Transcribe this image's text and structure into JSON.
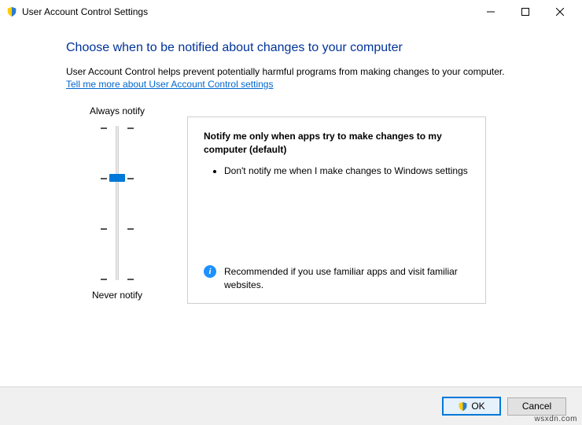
{
  "window": {
    "title": "User Account Control Settings"
  },
  "content": {
    "heading": "Choose when to be notified about changes to your computer",
    "description": "User Account Control helps prevent potentially harmful programs from making changes to your computer.",
    "link_text": "Tell me more about User Account Control settings"
  },
  "slider": {
    "top_label": "Always notify",
    "bottom_label": "Never notify",
    "levels": 4,
    "selected_index": 1
  },
  "panel": {
    "title": "Notify me only when apps try to make changes to my computer (default)",
    "bullets": [
      "Don't notify me when I make changes to Windows settings"
    ],
    "footer": "Recommended if you use familiar apps and visit familiar websites."
  },
  "buttons": {
    "ok": "OK",
    "cancel": "Cancel"
  },
  "watermark": "wsxdn.com"
}
